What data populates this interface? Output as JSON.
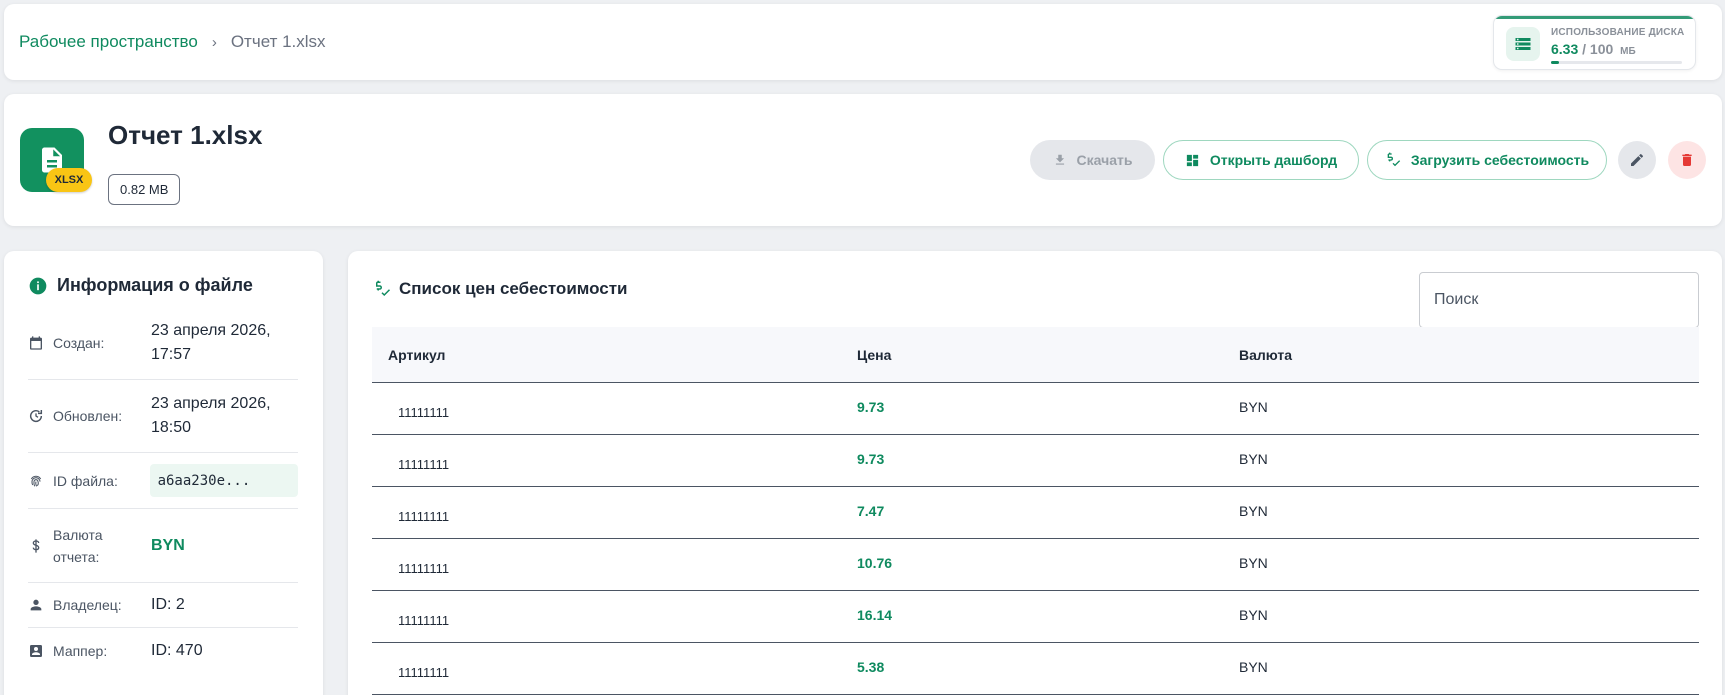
{
  "breadcrumb": {
    "workspace": "Рабочее пространство",
    "separator": "›",
    "current": "Отчет 1.xlsx"
  },
  "disk": {
    "title": "ИСПОЛЬЗОВАНИЕ ДИСКА",
    "used": "6.33",
    "separator": "/",
    "total": "100",
    "unit": "МБ",
    "used_fraction": 0.0633
  },
  "file": {
    "name": "Отчет 1.xlsx",
    "badge": "XLSX",
    "size": "0.82 MB"
  },
  "actions": {
    "download": "Скачать",
    "dashboard": "Открыть дашборд",
    "upload_cost": "Загрузить себестоимость"
  },
  "info": {
    "title": "Информация о файле",
    "rows": [
      {
        "label": "Создан:",
        "value": "23 апреля 2026, 17:57"
      },
      {
        "label": "Обновлен:",
        "value": "23 апреля 2026, 18:50"
      },
      {
        "label": "ID файла:",
        "value": "a6aa230e..."
      },
      {
        "label": "Валюта отчета:",
        "value": "BYN"
      },
      {
        "label": "Владелец:",
        "value": "ID: 2"
      },
      {
        "label": "Маппер:",
        "value": "ID: 470"
      }
    ]
  },
  "price_list": {
    "title": "Список цен себестоимости",
    "search_placeholder": "Поиск",
    "columns": [
      "Артикул",
      "Цена",
      "Валюта"
    ],
    "rows": [
      {
        "article": "11111111",
        "price": "9.73",
        "currency": "BYN"
      },
      {
        "article": "11111111",
        "price": "9.73",
        "currency": "BYN"
      },
      {
        "article": "11111111",
        "price": "7.47",
        "currency": "BYN"
      },
      {
        "article": "11111111",
        "price": "10.76",
        "currency": "BYN"
      },
      {
        "article": "11111111",
        "price": "16.14",
        "currency": "BYN"
      },
      {
        "article": "11111111",
        "price": "5.38",
        "currency": "BYN"
      }
    ]
  },
  "colors": {
    "accent": "#0f8a5f",
    "file_icon_bg": "#12915f",
    "badge": "#f9c514",
    "delete": "#e53935"
  }
}
